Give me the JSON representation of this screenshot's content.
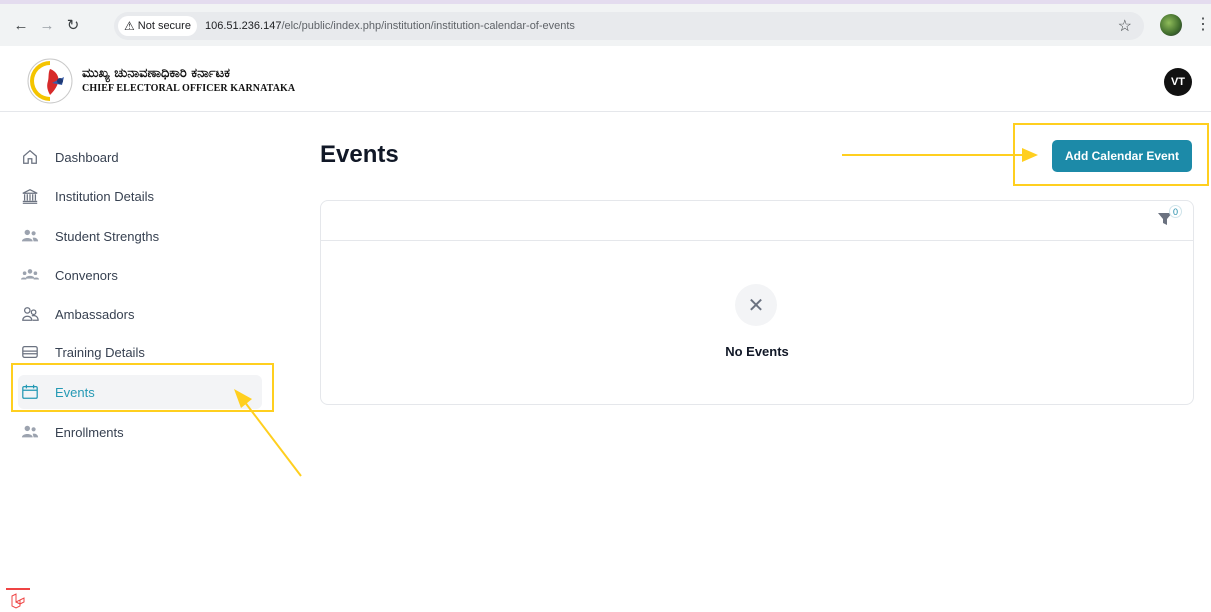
{
  "browser": {
    "security_label": "Not secure",
    "url_host": "106.51.236.147",
    "url_path": "/elc/public/index.php/institution/institution-calendar-of-events"
  },
  "header": {
    "logo_kannada": "ಮುಖ್ಯ ಚುನಾವಣಾಧಿಕಾರಿ ಕರ್ನಾಟಕ",
    "logo_english": "CHIEF ELECTORAL OFFICER KARNATAKA",
    "avatar_initials": "VT"
  },
  "sidebar": {
    "items": [
      {
        "label": "Dashboard",
        "icon": "home-icon"
      },
      {
        "label": "Institution Details",
        "icon": "institution-icon"
      },
      {
        "label": "Student Strengths",
        "icon": "users-icon"
      },
      {
        "label": "Convenors",
        "icon": "group-icon"
      },
      {
        "label": "Ambassadors",
        "icon": "ambassadors-icon"
      },
      {
        "label": "Training Details",
        "icon": "training-icon"
      },
      {
        "label": "Events",
        "icon": "calendar-icon",
        "active": true
      },
      {
        "label": "Enrollments",
        "icon": "users-icon"
      }
    ]
  },
  "main": {
    "title": "Events",
    "add_button_label": "Add Calendar Event",
    "filter_count": "0",
    "empty_text": "No Events"
  },
  "colors": {
    "accent": "#1c8aa8",
    "annotation": "#ffcf1f"
  }
}
